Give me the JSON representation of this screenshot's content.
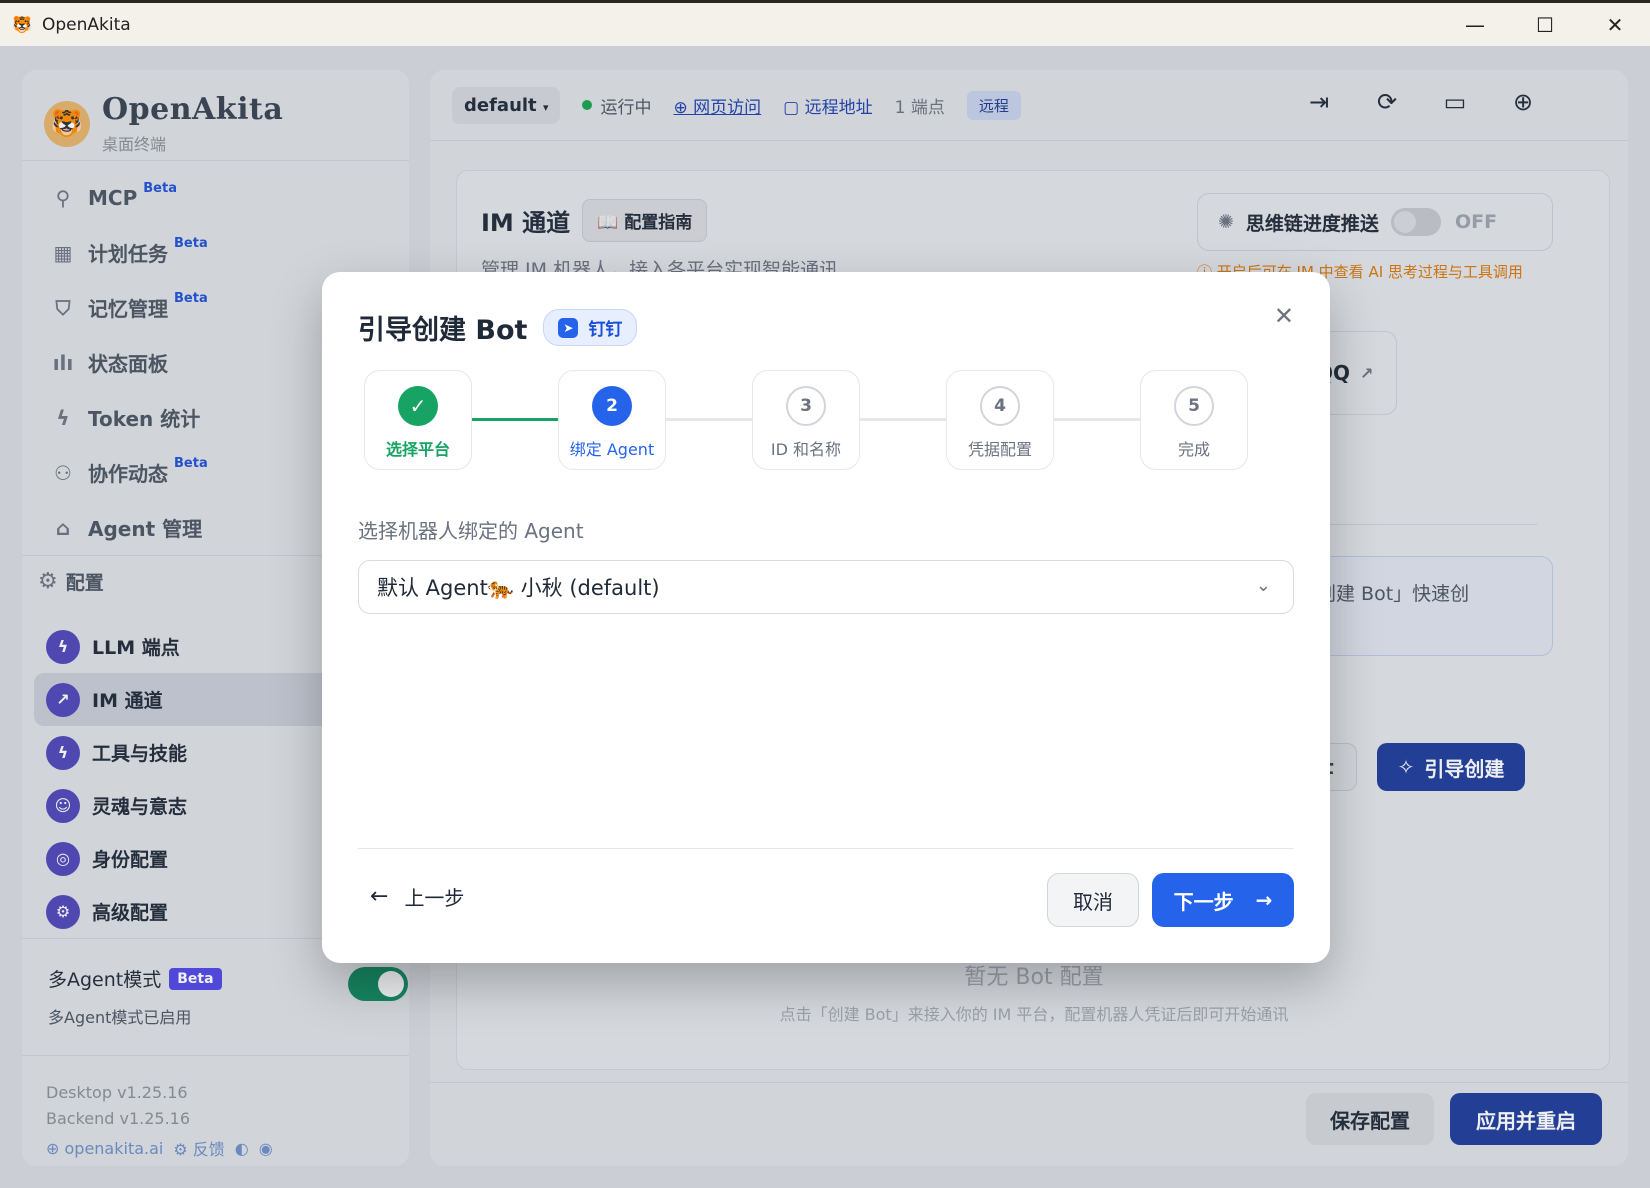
{
  "window": {
    "title": "OpenAkita",
    "icon": "tiger-icon",
    "controls": {
      "minimize": "—",
      "maximize": "☐",
      "close": "✕"
    }
  },
  "brand": {
    "name": "OpenAkita",
    "subtitle": "桌面终端"
  },
  "nav": {
    "items": [
      {
        "label": "MCP",
        "badge": "Beta",
        "icon": "plug-icon"
      },
      {
        "label": "计划任务",
        "badge": "Beta",
        "icon": "calendar-icon"
      },
      {
        "label": "记忆管理",
        "badge": "Beta",
        "icon": "shield-icon"
      },
      {
        "label": "状态面板",
        "badge": "",
        "icon": "bar-chart-icon"
      },
      {
        "label": "Token 统计",
        "badge": "",
        "icon": "zap-icon"
      },
      {
        "label": "协作动态",
        "badge": "Beta",
        "icon": "users-icon"
      },
      {
        "label": "Agent 管理",
        "badge": "",
        "icon": "bot-icon"
      }
    ],
    "config_header": "配置",
    "config_items": [
      {
        "label": "LLM 端点",
        "icon": "zap-icon"
      },
      {
        "label": "IM 通道",
        "icon": "share-icon"
      },
      {
        "label": "工具与技能",
        "icon": "zap-icon"
      },
      {
        "label": "灵魂与意志",
        "icon": "bot-icon"
      },
      {
        "label": "身份配置",
        "icon": "fingerprint-icon"
      },
      {
        "label": "高级配置",
        "icon": "gear-icon"
      }
    ]
  },
  "multi_agent": {
    "title": "多Agent模式",
    "badge": "Beta",
    "status": "多Agent模式已启用",
    "enabled": true
  },
  "versions": {
    "desktop": "Desktop v1.25.16",
    "backend": "Backend v1.25.16"
  },
  "footer_links": {
    "site": "⊕ openakita.ai",
    "feedback": "⚙ 反馈",
    "github": "◐",
    "other": "◉"
  },
  "topbar": {
    "env": "default",
    "env_caret": "▾",
    "status": "运行中",
    "web_access": "⊕ 网页访问",
    "remote_addr": "▢ 远程地址",
    "endpoints": "1 端点",
    "remote_badge": "远程",
    "icons": [
      "logout-icon",
      "refresh-icon",
      "monitor-icon",
      "globe-icon"
    ]
  },
  "im_card": {
    "title": "IM 通道",
    "guide_btn": "配置指南",
    "subtitle": "管理 IM 机器人，接入各平台实现智能通讯",
    "think_label": "思维链进度推送",
    "think_state": "OFF",
    "think_note": "ⓘ 开启后可在 IM 中查看 AI 思考过程与工具调用",
    "qq_label": "QQ",
    "info_text": "「创建 Bot」快速创",
    "bot_btn": "ot",
    "guide_create": "引导创建",
    "empty_title": "暂无 Bot 配置",
    "empty_sub": "点击「创建 Bot」来接入你的 IM 平台，配置机器人凭证后即可开始通讯"
  },
  "actions": {
    "save": "保存配置",
    "apply": "应用并重启"
  },
  "modal": {
    "title": "引导创建 Bot",
    "platform": "钉钉",
    "close": "✕",
    "steps": [
      {
        "num": "✓",
        "label": "选择平台",
        "state": "done"
      },
      {
        "num": "2",
        "label": "绑定 Agent",
        "state": "current"
      },
      {
        "num": "3",
        "label": "ID 和名称",
        "state": "todo"
      },
      {
        "num": "4",
        "label": "凭据配置",
        "state": "todo"
      },
      {
        "num": "5",
        "label": "完成",
        "state": "todo"
      }
    ],
    "field_label": "选择机器人绑定的 Agent",
    "selected_agent": "默认 Agent🐅 小秋 (default)",
    "prev": "上一步",
    "cancel": "取消",
    "next": "下一步"
  },
  "colors": {
    "primary": "#2563eb",
    "success": "#16a364",
    "brand_dark": "#1e3a9a",
    "warning": "#d97706"
  }
}
